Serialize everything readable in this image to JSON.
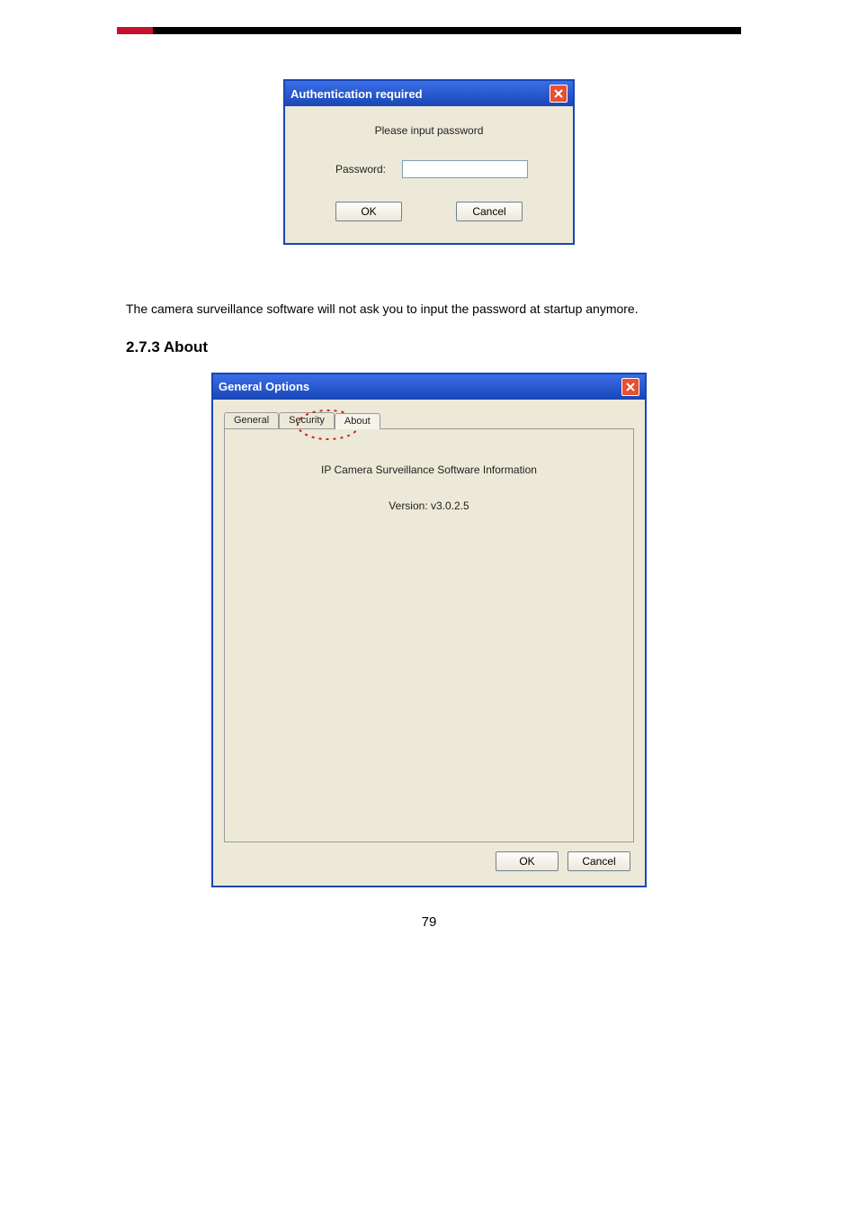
{
  "doc": {
    "page_number": "79",
    "body_text": "The camera surveillance software will not ask you to input the password at startup anymore.",
    "section_heading": "2.7.3 About"
  },
  "auth": {
    "title": "Authentication required",
    "message": "Please input password",
    "label": "Password:",
    "value": "",
    "ok": "OK",
    "cancel": "Cancel"
  },
  "options": {
    "title": "General Options",
    "tabs": {
      "general": "General",
      "security": "Security",
      "about": "About"
    },
    "about": {
      "heading": "IP Camera Surveillance Software Information",
      "version": "Version: v3.0.2.5"
    },
    "ok": "OK",
    "cancel": "Cancel"
  }
}
